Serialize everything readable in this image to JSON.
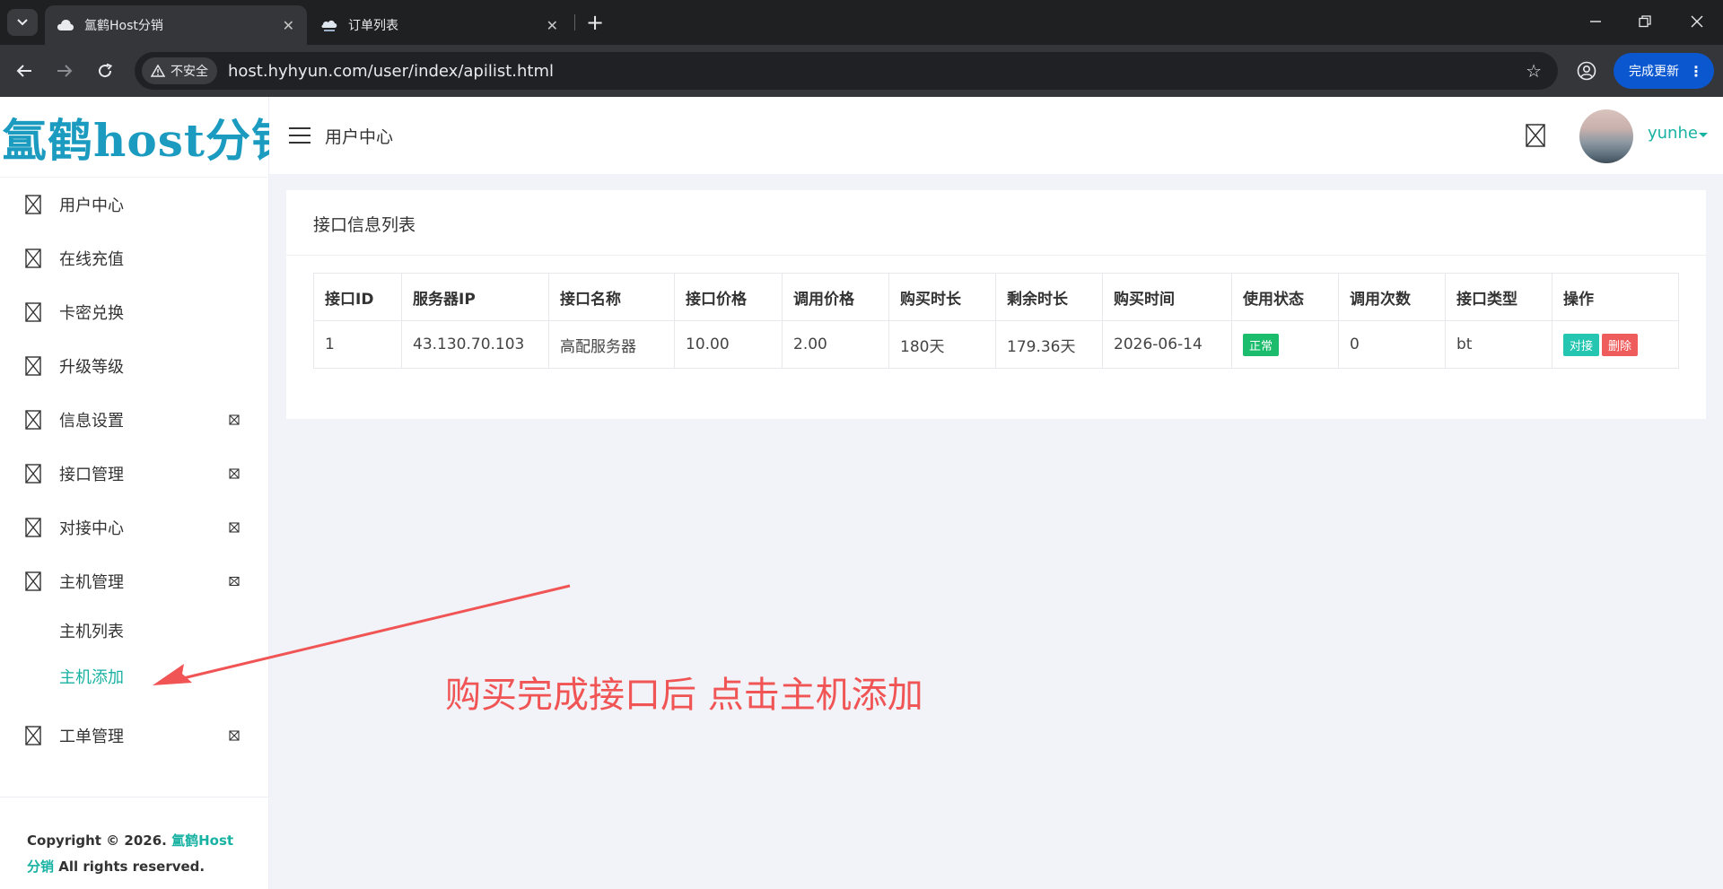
{
  "browser": {
    "tabs": [
      {
        "title": "氲鹤Host分销",
        "active": true
      },
      {
        "title": "订单列表",
        "active": false
      }
    ],
    "security_label": "不安全",
    "url": "host.hyhyun.com/user/index/apilist.html",
    "update_label": "完成更新"
  },
  "sidebar": {
    "logo": "氲鹤host分销",
    "items": [
      {
        "label": "用户中心",
        "icon": "broken-image-icon",
        "has_arrow": false
      },
      {
        "label": "在线充值",
        "icon": "broken-image-icon",
        "has_arrow": false
      },
      {
        "label": "卡密兑换",
        "icon": "broken-image-icon",
        "has_arrow": false
      },
      {
        "label": "升级等级",
        "icon": "broken-image-icon",
        "has_arrow": false
      },
      {
        "label": "信息设置",
        "icon": "broken-image-icon",
        "has_arrow": true
      },
      {
        "label": "接口管理",
        "icon": "broken-image-icon",
        "has_arrow": true
      },
      {
        "label": "对接中心",
        "icon": "broken-image-icon",
        "has_arrow": true
      },
      {
        "label": "主机管理",
        "icon": "broken-image-icon",
        "has_arrow": true,
        "expanded": true
      },
      {
        "label": "工单管理",
        "icon": "broken-image-icon",
        "has_arrow": true
      }
    ],
    "subitems": [
      {
        "label": "主机列表",
        "active": false
      },
      {
        "label": "主机添加",
        "active": true
      }
    ],
    "footer": {
      "prefix": "Copyright © 2026.",
      "brand": "氲鹤Host分销",
      "suffix": "All rights reserved."
    }
  },
  "header": {
    "breadcrumb": "用户中心",
    "username": "yunhe"
  },
  "card": {
    "title": "接口信息列表",
    "columns": [
      "接口ID",
      "服务器IP",
      "接口名称",
      "接口价格",
      "调用价格",
      "购买时长",
      "剩余时长",
      "购买时间",
      "使用状态",
      "调用次数",
      "接口类型",
      "操作"
    ],
    "rows": [
      {
        "id": "1",
        "ip": "43.130.70.103",
        "name": "高配服务器",
        "price": "10.00",
        "call_price": "2.00",
        "duration": "180天",
        "remaining": "179.36天",
        "buy_time": "2026-06-14",
        "status": "正常",
        "calls": "0",
        "type": "bt",
        "action_dock": "对接",
        "action_delete": "删除"
      }
    ]
  },
  "annotation": {
    "text": "购买完成接口后 点击主机添加"
  },
  "colors": {
    "accent": "#18b2a2",
    "status_ok": "#1bbc6b",
    "danger": "#ef5c5c",
    "annotation": "#f05454"
  }
}
